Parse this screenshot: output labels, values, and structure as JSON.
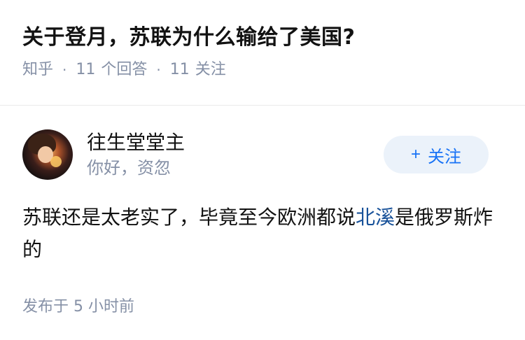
{
  "question": {
    "title": "关于登月，苏联为什么输给了美国?",
    "source": "知乎",
    "answers_count": "11",
    "answers_label": "个回答",
    "followers_count": "11",
    "followers_label": "关注"
  },
  "answer": {
    "author": {
      "name": "往生堂堂主",
      "bio": "你好，资忽",
      "avatar_icon": "avatar-anime-character"
    },
    "follow_button": {
      "icon": "+",
      "label": "关注"
    },
    "content": {
      "before": "苏联还是太老实了，毕竟至今欧洲都说",
      "link": "北溪",
      "after": "是俄罗斯炸的"
    },
    "time": "发布于 5 小时前"
  },
  "colors": {
    "muted": "#8590a6",
    "accent": "#1772f6",
    "link": "#175199",
    "button_bg": "#ebf2fa"
  }
}
